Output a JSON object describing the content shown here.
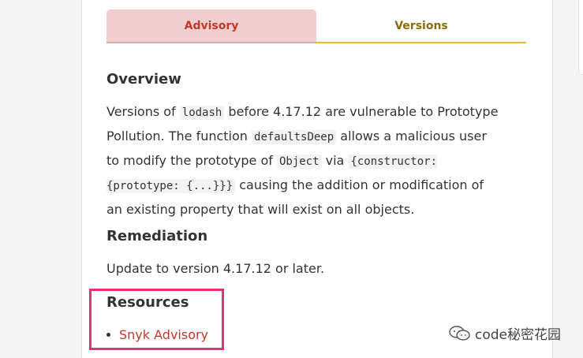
{
  "tabs": {
    "advisory": "Advisory",
    "versions": "Versions"
  },
  "overview": {
    "heading": "Overview",
    "t1": "Versions of ",
    "code1": "lodash",
    "t2": " before 4.17.12 are vulnerable to Prototype Pollution. The function ",
    "code2": "defaultsDeep",
    "t3": " allows a malicious user to modify the prototype of ",
    "code3": "Object",
    "t4": " via ",
    "code4": "{constructor: {prototype: {...}}}",
    "t5": " causing the addition or modification of an existing property that will exist on all objects."
  },
  "remediation": {
    "heading": "Remediation",
    "text": "Update to version 4.17.12 or later."
  },
  "resources": {
    "heading": "Resources",
    "links": [
      "Snyk Advisory"
    ]
  },
  "watermark": {
    "text": "code秘密花园"
  },
  "colors": {
    "highlight_box": "#e5307a",
    "link": "#c0392b",
    "advisory_tab_bg": "#f2cfcf",
    "versions_tab_underline": "#e8b830"
  }
}
